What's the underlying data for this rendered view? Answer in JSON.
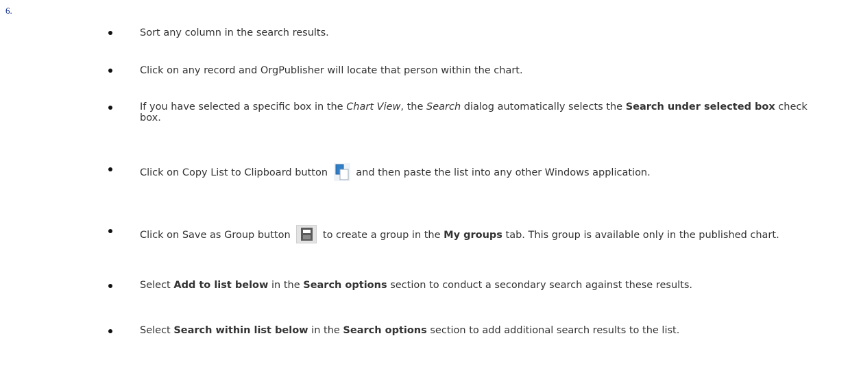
{
  "step_number": "6.",
  "items": [
    {
      "text": "Sort any column in the search results."
    },
    {
      "text": "Click on any record and OrgPublisher will locate that person within the chart."
    },
    {
      "p1": "If you have selected a specific box in the ",
      "em1": "Chart View",
      "p2": ", the ",
      "em2": "Search",
      "p3": " dialog automatically selects the ",
      "b1": "Search under selected box",
      "p4": " check box."
    },
    {
      "p1": "Click on Copy List to Clipboard button ",
      "icon": "copy-to-clipboard-icon",
      "p2": " and then paste the list into any other Windows application."
    },
    {
      "p1": "Click on Save as Group button ",
      "icon": "save-as-group-icon",
      "p2": " to create a group in the ",
      "b1": "My groups",
      "p3": " tab. This group is available only in the published chart."
    },
    {
      "p1": "Select ",
      "b1": "Add to list below",
      "p2": " in the ",
      "b2": "Search options",
      "p3": " section to conduct a secondary search against these results."
    },
    {
      "p1": "Select ",
      "b1": "Search within list below",
      "p2": " in the ",
      "b2": "Search options",
      "p3": " section to add additional search results to the list."
    }
  ],
  "colors": {
    "step_number": "#0d2b8a",
    "text": "#333333",
    "copy_icon_blue": "#2f7fc8"
  }
}
